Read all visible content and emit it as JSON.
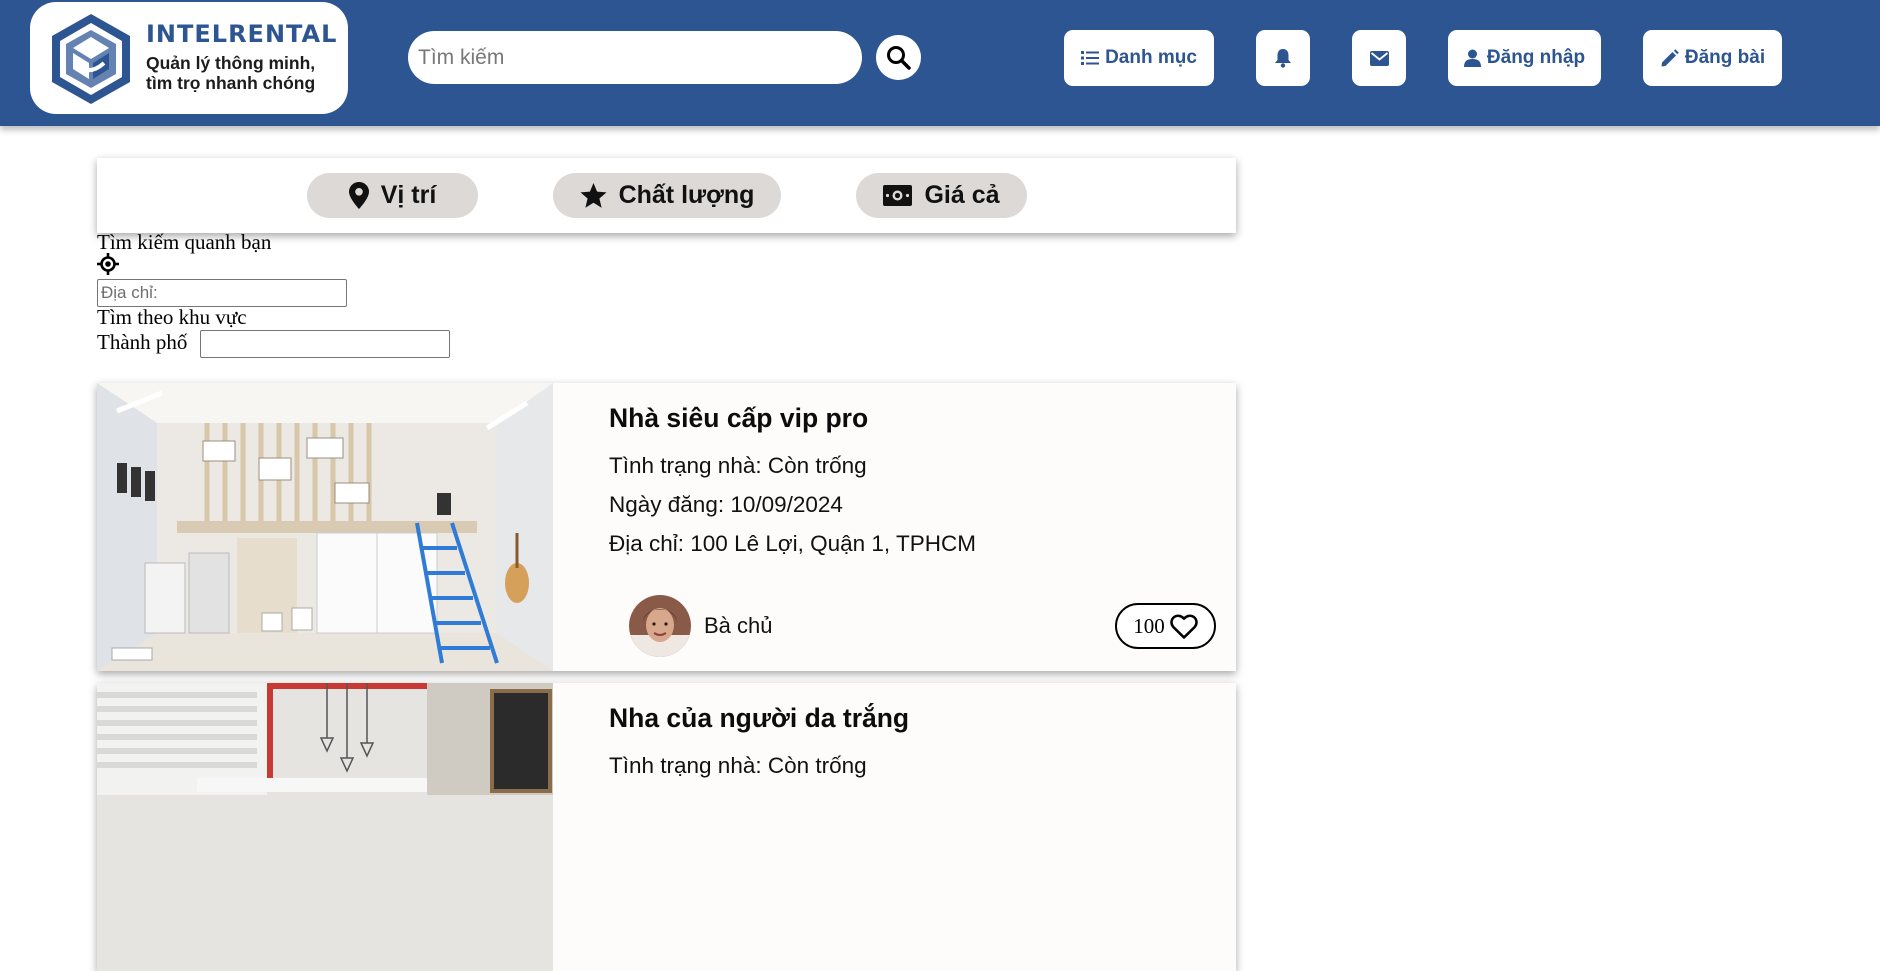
{
  "brand": {
    "name": "INTELRENTAL",
    "tagline_line1": "Quản lý thông minh,",
    "tagline_line2": "tìm trọ nhanh chóng"
  },
  "search": {
    "placeholder": "Tìm kiếm"
  },
  "header": {
    "category_label": "Danh mục",
    "login_label": "Đăng nhập",
    "post_label": "Đăng bài"
  },
  "filters": {
    "location_label": "Vị trí",
    "quality_label": "Chất lượng",
    "price_label": "Giá cả"
  },
  "nearby": {
    "heading": "Tìm kiếm quanh bạn",
    "address_placeholder": "Địa chỉ:",
    "area_heading": "Tìm theo khu vực",
    "city_label": "Thành phố"
  },
  "listings": [
    {
      "title": "Nhà siêu cấp vip pro",
      "status": "Tình trạng nhà: Còn trống",
      "date": "Ngày đăng: 10/09/2024",
      "address": "Địa chỉ: 100 Lê Lợi, Quận 1, TPHCM",
      "owner": "Bà chủ",
      "likes": "100"
    },
    {
      "title": "Nha của người da trắng",
      "status": "Tình trạng nhà: Còn trống"
    }
  ],
  "icons": {
    "search": "magnifier-icon",
    "category": "list-icon",
    "bell": "bell-icon",
    "mail": "envelope-icon",
    "user": "user-icon",
    "post": "pencil-icon",
    "location": "map-pin-icon",
    "quality": "star-icon",
    "price": "money-bill-icon",
    "locate": "crosshairs-icon",
    "like": "heart-icon"
  },
  "colors": {
    "header_bg": "#2d5591",
    "accent": "#2d5591",
    "pill_bg": "#dcd9d7",
    "card_bg": "#fdfcfa"
  }
}
